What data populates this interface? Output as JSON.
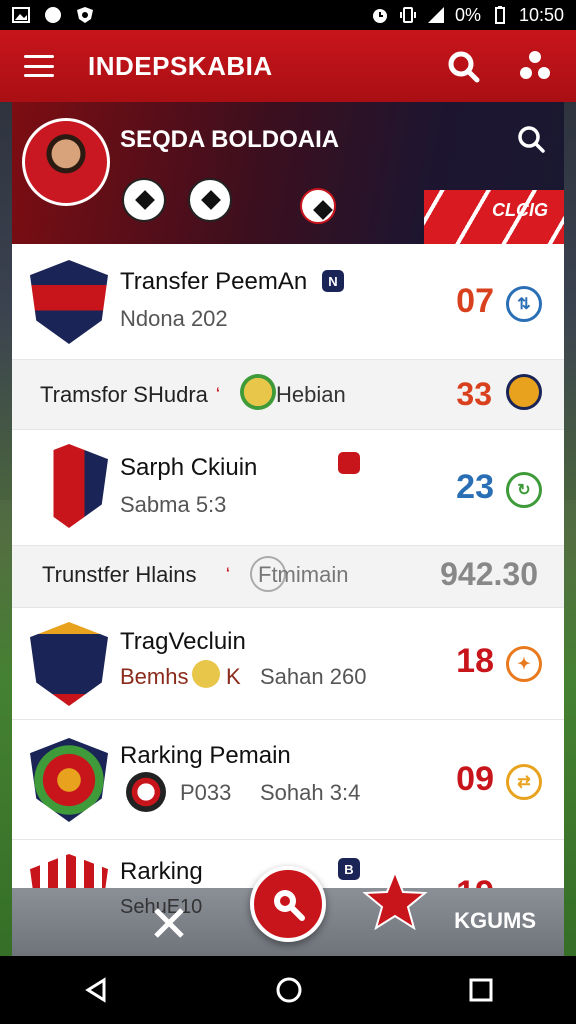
{
  "status_bar": {
    "battery_text": "0%",
    "time": "10:50"
  },
  "app_bar": {
    "title": "INDEPSKABIA"
  },
  "hero": {
    "player_name": "SEQDA BOLDOAIA",
    "tag": "CLCIG"
  },
  "rows": [
    {
      "kind": "team",
      "name": "Transfer PeemAn",
      "sub": "Ndona 202",
      "badge": "N",
      "score": "07",
      "score_color": "#d9401e",
      "icon_color": "#2a6fb5"
    },
    {
      "kind": "transfer",
      "text": "Tramsfor SHudra",
      "label": "Hebian",
      "value": "33",
      "value_color": "#d9401e"
    },
    {
      "kind": "team",
      "name": "Sarph Ckiuin",
      "sub": "Sabma 5:3",
      "badge": "",
      "score": "23",
      "score_color": "#2a6fb5",
      "icon_color": "#3f9a3a"
    },
    {
      "kind": "transfer",
      "text": "Trunstfer Hlains",
      "label": "Ftmimain",
      "value": "942.30",
      "value_color": "#888888"
    },
    {
      "kind": "team",
      "name": "TragVecluin",
      "sub_left": "Bemhs",
      "sub_mid": "K",
      "sub_right": "Sahan 260",
      "score": "18",
      "score_color": "#c8151b",
      "icon_color": "#e87a1d"
    },
    {
      "kind": "team",
      "name": "Rarking Pemain",
      "sub_left": "P033",
      "sub_right": "Sohah 3:4",
      "score": "09",
      "score_color": "#c8151b",
      "icon_color": "#e8a21d"
    },
    {
      "kind": "team",
      "name": "Rarking",
      "sub": "SehuE10",
      "badge": "B",
      "score": "19",
      "score_color": "#c8151b",
      "icon_color": "#666666"
    }
  ],
  "bottom_bar": {
    "label": "KGUMS"
  },
  "icons": {
    "menu": "hamburger-icon",
    "search": "search-icon",
    "profile": "people-icon",
    "star": "star-icon",
    "back": "back-icon",
    "home": "home-icon",
    "recents": "recents-icon"
  },
  "colors": {
    "primary": "#c8151b",
    "accent": "#d9401e"
  }
}
